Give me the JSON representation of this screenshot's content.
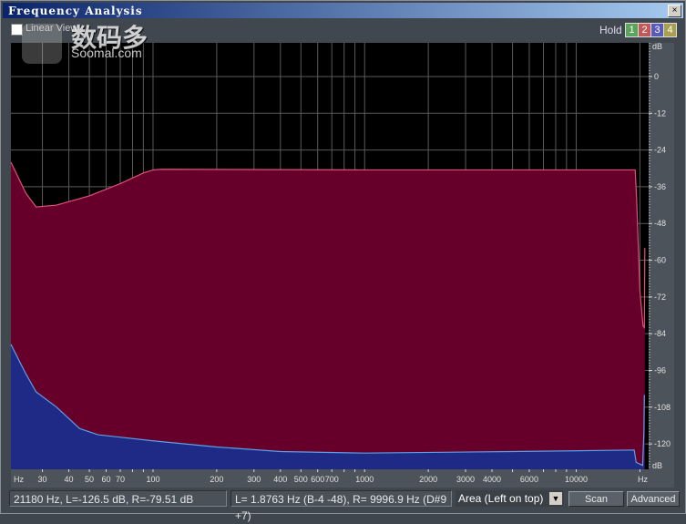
{
  "window": {
    "title": "Frequency Analysis",
    "close_label": "×"
  },
  "toolbar": {
    "linear_view_label": "Linear View",
    "linear_view_checked": false,
    "hold_label": "Hold",
    "hold_buttons": [
      {
        "label": "1",
        "color": "#5aa55a"
      },
      {
        "label": "2",
        "color": "#c05a5a"
      },
      {
        "label": "3",
        "color": "#5a5ab8"
      },
      {
        "label": "4",
        "color": "#a8a050"
      }
    ]
  },
  "watermark": {
    "cn": "数码多",
    "en": "Soomal.com"
  },
  "chart_data": {
    "type": "area",
    "x_scale": "log",
    "xlim": [
      21.3,
      22000
    ],
    "ylim": [
      -128.3,
      11
    ],
    "x_unit": "Hz",
    "y_unit": "dB",
    "x_ticks": [
      30,
      40,
      50,
      60,
      70,
      100,
      200,
      300,
      400,
      500,
      600,
      700,
      1000,
      2000,
      3000,
      4000,
      6000,
      10000
    ],
    "x_grid": [
      30,
      40,
      50,
      60,
      70,
      80,
      90,
      100,
      200,
      300,
      400,
      500,
      600,
      700,
      800,
      900,
      1000,
      2000,
      3000,
      4000,
      5000,
      6000,
      7000,
      8000,
      9000,
      10000,
      20000
    ],
    "y_ticks": [
      0,
      -12,
      -24,
      -36,
      -48,
      -60,
      -72,
      -84,
      -96,
      -108,
      -120
    ],
    "grid": true,
    "series": [
      {
        "color": "#66002a",
        "line": "#e0507a",
        "points": [
          [
            21.3,
            -28
          ],
          [
            25,
            -38
          ],
          [
            28,
            -42.6
          ],
          [
            35,
            -42
          ],
          [
            50,
            -39
          ],
          [
            70,
            -35
          ],
          [
            90,
            -31.5
          ],
          [
            100,
            -30.5
          ],
          [
            110,
            -30.3
          ],
          [
            1000,
            -30.5
          ],
          [
            19000,
            -30.5
          ],
          [
            19300,
            -40
          ],
          [
            20000,
            -70
          ],
          [
            20700,
            -81.5
          ],
          [
            21000,
            -82
          ],
          [
            21100,
            -56
          ]
        ]
      },
      {
        "color": "#1e2a86",
        "line": "#5aa0e8",
        "points": [
          [
            21.3,
            -87.5
          ],
          [
            25,
            -97
          ],
          [
            28,
            -103
          ],
          [
            35,
            -108
          ],
          [
            45,
            -115
          ],
          [
            55,
            -117
          ],
          [
            100,
            -119
          ],
          [
            200,
            -121
          ],
          [
            400,
            -122.5
          ],
          [
            1000,
            -123
          ],
          [
            5000,
            -122.5
          ],
          [
            18800,
            -122
          ],
          [
            19200,
            -126
          ],
          [
            20600,
            -127
          ],
          [
            20900,
            -116
          ],
          [
            21000,
            -104
          ]
        ]
      }
    ]
  },
  "status": {
    "cursor": "21180 Hz, L=-126.5 dB, R=-79.51 dB",
    "peaks": "L= 1.8763 Hz (B-4 -48), R= 9996.9 Hz (D#9 +7)"
  },
  "mode_select": {
    "value": "Area (Left on top)"
  },
  "buttons": {
    "scan": "Scan",
    "advanced": "Advanced"
  }
}
